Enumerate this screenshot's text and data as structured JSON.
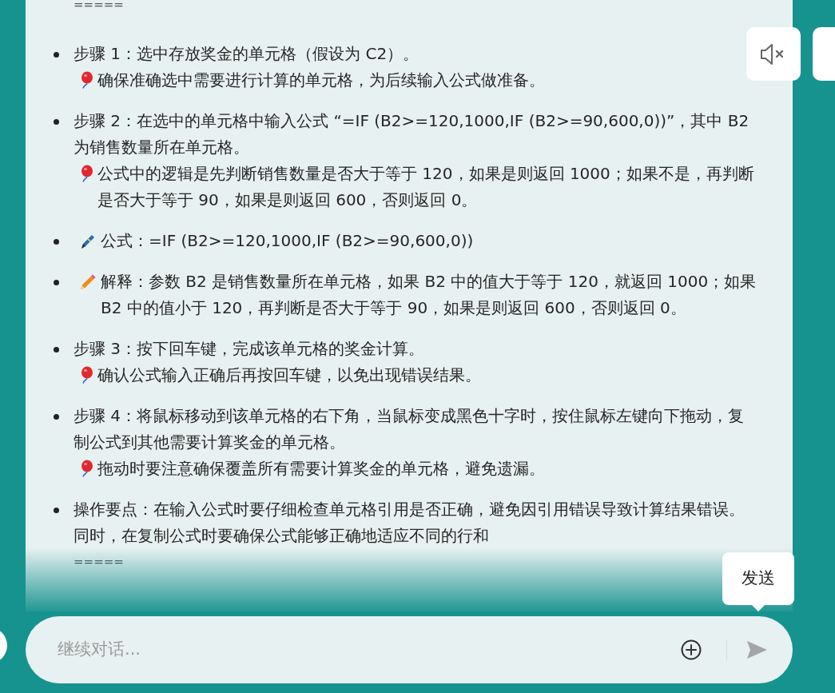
{
  "message": {
    "top_rule": "=====",
    "items": [
      {
        "kind": "plain",
        "text": "步骤 1：选中存放奖金的单元格（假设为 C2）。",
        "note": "确保准确选中需要进行计算的单元格，为后续输入公式做准备。"
      },
      {
        "kind": "plain",
        "text": "步骤 2：在选中的单元格中输入公式 “=IF (B2>=120,1000,IF (B2>=90,600,0))”，其中 B2 为销售数量所在单元格。",
        "note": "公式中的逻辑是先判断销售数量是否大于等于 120，如果是则返回 1000；如果不是，再判断是否大于等于 90，如果是则返回 600，否则返回 0。"
      },
      {
        "kind": "pen",
        "text": "公式：=IF (B2>=120,1000,IF (B2>=90,600,0))"
      },
      {
        "kind": "pencil",
        "text": "解释：参数 B2 是销售数量所在单元格，如果 B2 中的值大于等于 120，就返回 1000；如果 B2 中的值小于 120，再判断是否大于等于 90，如果是则返回 600，否则返回 0。"
      },
      {
        "kind": "plain",
        "text": "步骤 3：按下回车键，完成该单元格的奖金计算。",
        "note": "确认公式输入正确后再按回车键，以免出现错误结果。"
      },
      {
        "kind": "plain",
        "text": "步骤 4：将鼠标移动到该单元格的右下角，当鼠标变成黑色十字时，按住鼠标左键向下拖动，复制公式到其他需要计算奖金的单元格。",
        "note": "拖动时要注意确保覆盖所有需要计算奖金的单元格，避免遗漏。"
      },
      {
        "kind": "plain",
        "text": "操作要点：在输入公式时要仔细检查单元格引用是否正确，避免因引用错误导致计算结果错误。同时，在复制公式时要确保公式能够正确地适应不同的行和"
      }
    ],
    "bottom_rule": "====="
  },
  "input": {
    "placeholder": "继续对话..."
  },
  "send_tooltip": "发送"
}
